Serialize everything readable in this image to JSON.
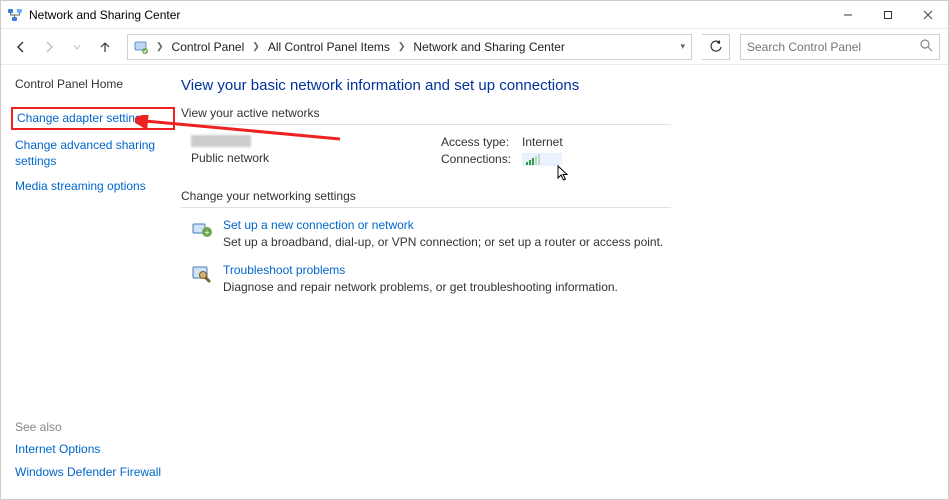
{
  "window": {
    "title": "Network and Sharing Center"
  },
  "breadcrumb": {
    "items": [
      "Control Panel",
      "All Control Panel Items",
      "Network and Sharing Center"
    ]
  },
  "search": {
    "placeholder": "Search Control Panel"
  },
  "sidebar": {
    "home_label": "Control Panel Home",
    "links": [
      "Change adapter settings",
      "Change advanced sharing settings",
      "Media streaming options"
    ]
  },
  "see_also": {
    "heading": "See also",
    "links": [
      "Internet Options",
      "Windows Defender Firewall"
    ]
  },
  "main": {
    "heading": "View your basic network information and set up connections",
    "active_label": "View your active networks",
    "network": {
      "type_label": "Public network",
      "access_label": "Access type:",
      "access_value": "Internet",
      "connections_label": "Connections:"
    },
    "change_label": "Change your networking settings",
    "actions": [
      {
        "title": "Set up a new connection or network",
        "desc": "Set up a broadband, dial-up, or VPN connection; or set up a router or access point."
      },
      {
        "title": "Troubleshoot problems",
        "desc": "Diagnose and repair network problems, or get troubleshooting information."
      }
    ]
  }
}
